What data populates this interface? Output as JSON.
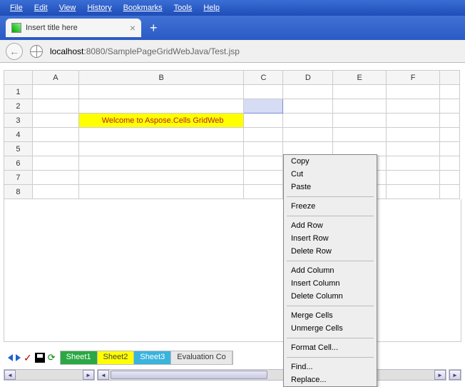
{
  "menubar": [
    "File",
    "Edit",
    "View",
    "History",
    "Bookmarks",
    "Tools",
    "Help"
  ],
  "tab": {
    "title": "Insert title here"
  },
  "url": {
    "host": "localhost",
    "rest": ":8080/SamplePageGridWebJava/Test.jsp"
  },
  "grid": {
    "columns": [
      "A",
      "B",
      "C",
      "D",
      "E",
      "F"
    ],
    "rows": [
      "1",
      "2",
      "3",
      "4",
      "5",
      "6",
      "7",
      "8"
    ],
    "cell_b3": "Welcome to Aspose.Cells GridWeb"
  },
  "context_menu": {
    "groups": [
      [
        "Copy",
        "Cut",
        "Paste"
      ],
      [
        "Freeze"
      ],
      [
        "Add Row",
        "Insert Row",
        "Delete Row"
      ],
      [
        "Add Column",
        "Insert Column",
        "Delete Column"
      ],
      [
        "Merge Cells",
        "Unmerge Cells"
      ],
      [
        "Format Cell..."
      ],
      [
        "Find...",
        "Replace..."
      ]
    ]
  },
  "sheet_tabs": [
    {
      "label": "Sheet1",
      "cls": "st-green"
    },
    {
      "label": "Sheet2",
      "cls": "st-yellow"
    },
    {
      "label": "Sheet3",
      "cls": "st-cyan"
    },
    {
      "label": "Evaluation Co",
      "cls": "st-gray"
    }
  ],
  "icons": {
    "tick": "✓",
    "refresh": "⟳",
    "chev_l": "◄",
    "chev_r": "►"
  }
}
